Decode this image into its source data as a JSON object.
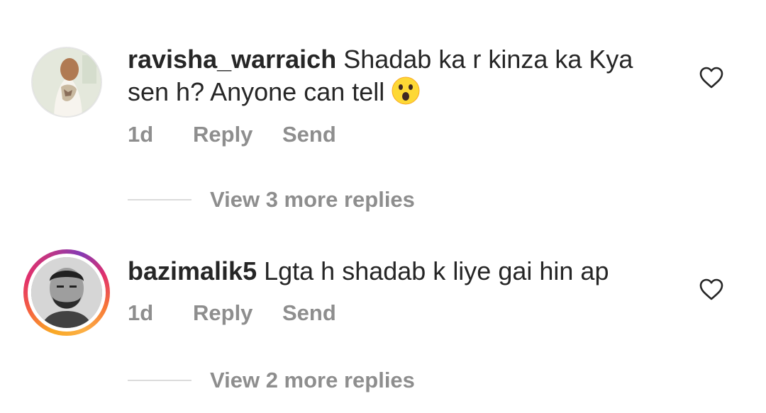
{
  "comments": [
    {
      "username": "ravisha_warraich",
      "text_line1": "Shadab ka r kinza ka Kya",
      "text_line2": "sen h? Anyone can tell",
      "emoji_icon": "astonished-face-emoji",
      "time": "1d",
      "reply_label": "Reply",
      "send_label": "Send",
      "view_replies": "View 3 more replies",
      "avatar_icon": "avatar-photo",
      "like_icon": "heart-outline-icon"
    },
    {
      "username": "bazimalik5",
      "text_line1": "Lgta h shadab k liye gai hin ap",
      "time": "1d",
      "reply_label": "Reply",
      "send_label": "Send",
      "view_replies": "View 2 more replies",
      "avatar_icon": "avatar-photo-story-ring",
      "like_icon": "heart-outline-icon"
    }
  ],
  "colors": {
    "text": "#262626",
    "secondary": "#8e8e8e",
    "divider": "#dbdbdb",
    "emoji_yellow": "#fdd835"
  }
}
